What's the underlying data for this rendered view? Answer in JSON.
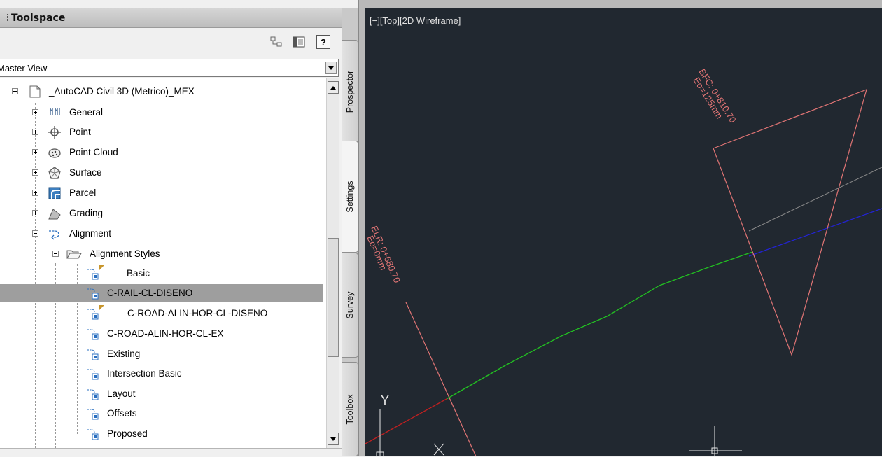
{
  "toolspace": {
    "title": "Toolspace",
    "toolbar_icons": [
      "item-view-icon",
      "panel-icon",
      "help-icon"
    ],
    "help_label": "?",
    "view": "Master View"
  },
  "tree": {
    "root": "_AutoCAD Civil 3D (Metrico)_MEX",
    "items": [
      {
        "label": "General",
        "icon": "general-icon"
      },
      {
        "label": "Point",
        "icon": "point-icon"
      },
      {
        "label": "Point Cloud",
        "icon": "point-cloud-icon"
      },
      {
        "label": "Surface",
        "icon": "surface-icon"
      },
      {
        "label": "Parcel",
        "icon": "parcel-icon"
      },
      {
        "label": "Grading",
        "icon": "grading-icon"
      },
      {
        "label": "Alignment",
        "icon": "alignment-icon"
      }
    ],
    "alignment_styles": {
      "label": "Alignment Styles",
      "styles": [
        {
          "label": "Basic",
          "flag": true
        },
        {
          "label": "C-RAIL-CL-DISENO",
          "selected": true
        },
        {
          "label": "C-ROAD-ALIN-HOR-CL-DISENO",
          "flag": true
        },
        {
          "label": "C-ROAD-ALIN-HOR-CL-EX"
        },
        {
          "label": "Existing"
        },
        {
          "label": "Intersection Basic"
        },
        {
          "label": "Layout"
        },
        {
          "label": "Offsets"
        },
        {
          "label": "Proposed"
        }
      ]
    }
  },
  "tabs": [
    "Prospector",
    "Settings",
    "Survey",
    "Toolbox"
  ],
  "viewport": {
    "label": "[−][Top][2D Wireframe]",
    "label_bfc": "BFC: 0+810.70",
    "label_bfc_sub": "Eo=125mm",
    "label_elr": "ELR: 0+680.70",
    "label_elr_sub": "Eo=0mm",
    "ucs_y": "Y",
    "colors": {
      "background": "#212830",
      "marker": "#e07474",
      "align_green": "#22c022",
      "align_blue": "#2323d8",
      "align_red": "#c02020",
      "align_gray": "#8a8a8a"
    }
  }
}
